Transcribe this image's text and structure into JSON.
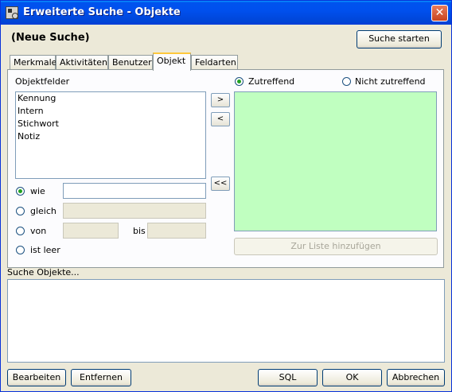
{
  "window": {
    "title": "Erweiterte Suche - Objekte",
    "close_glyph": "✕"
  },
  "header": {
    "search_name": "(Neue Suche)",
    "start_button": "Suche starten"
  },
  "tabs": [
    {
      "label": "Merkmale",
      "active": false
    },
    {
      "label": "Aktivitäten",
      "active": false
    },
    {
      "label": "Benutzer",
      "active": false
    },
    {
      "label": "Objekt",
      "active": true
    },
    {
      "label": "Feldarten",
      "active": false
    }
  ],
  "objekt": {
    "fields_label": "Objektfelder",
    "fields": [
      "Kennung",
      "Intern",
      "Stichwort",
      "Notiz"
    ],
    "add_button": ">",
    "remove_button": "<",
    "remove_all_button": "<<",
    "match_options": {
      "zutreffend": "Zutreffend",
      "nicht_zutreffend": "Nicht zutreffend",
      "selected": "Zutreffend"
    },
    "conditions": {
      "wie": "wie",
      "gleich": "gleich",
      "von": "von",
      "bis": "bis",
      "ist_leer": "ist leer",
      "selected": "wie"
    },
    "add_to_list_button": "Zur Liste hinzufügen"
  },
  "results": {
    "label": "Suche Objekte..."
  },
  "footer": {
    "edit_button": "Bearbeiten",
    "remove_button": "Entfernen",
    "sql_button": "SQL",
    "ok_button": "OK",
    "cancel_button": "Abbrechen"
  },
  "colors": {
    "title_bar": "#0054e3",
    "criteria_background": "#c0ffc0",
    "dialog_background": "#ece9d8"
  }
}
